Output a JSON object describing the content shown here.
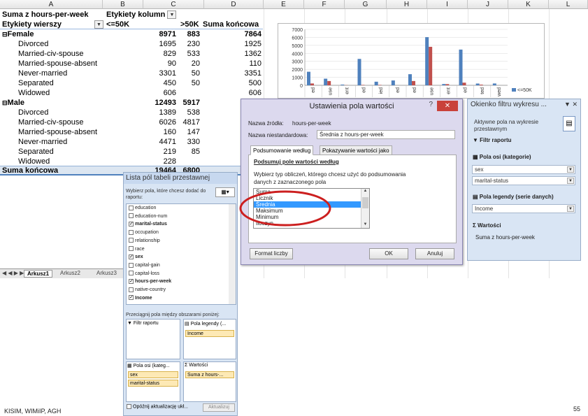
{
  "columns": [
    "A",
    "B",
    "C",
    "D",
    "E",
    "F",
    "G",
    "H",
    "I",
    "J",
    "K",
    "L"
  ],
  "pivot": {
    "title": "Suma z hours-per-week",
    "col_labels_header": "Etykiety kolumn",
    "row_labels_header": "Etykiety wierszy",
    "col1": "<=50K",
    "col2": ">50K",
    "col_total": "Suma końcowa",
    "rows": [
      {
        "label": "Female",
        "v1": "8971",
        "v2": "883",
        "t": "7864",
        "level": 0,
        "collapse": "⊟"
      },
      {
        "label": "Divorced",
        "v1": "1695",
        "v2": "230",
        "t": "1925",
        "level": 1
      },
      {
        "label": "Married-civ-spouse",
        "v1": "829",
        "v2": "533",
        "t": "1362",
        "level": 1
      },
      {
        "label": "Married-spouse-absent",
        "v1": "90",
        "v2": "20",
        "t": "110",
        "level": 1
      },
      {
        "label": "Never-married",
        "v1": "3301",
        "v2": "50",
        "t": "3351",
        "level": 1
      },
      {
        "label": "Separated",
        "v1": "450",
        "v2": "50",
        "t": "500",
        "level": 1
      },
      {
        "label": "Widowed",
        "v1": "606",
        "v2": "",
        "t": "606",
        "level": 1
      },
      {
        "label": "Male",
        "v1": "12493",
        "v2": "5917",
        "t": "",
        "level": 0,
        "collapse": "⊟"
      },
      {
        "label": "Divorced",
        "v1": "1389",
        "v2": "538",
        "t": "",
        "level": 1
      },
      {
        "label": "Married-civ-spouse",
        "v1": "6026",
        "v2": "4817",
        "t": "",
        "level": 1
      },
      {
        "label": "Married-spouse-absent",
        "v1": "160",
        "v2": "147",
        "t": "",
        "level": 1
      },
      {
        "label": "Never-married",
        "v1": "4471",
        "v2": "330",
        "t": "",
        "level": 1
      },
      {
        "label": "Separated",
        "v1": "219",
        "v2": "85",
        "t": "",
        "level": 1
      },
      {
        "label": "Widowed",
        "v1": "228",
        "v2": "",
        "t": "",
        "level": 1
      }
    ],
    "grand_label": "Suma końcowa",
    "grand_v1": "19464",
    "grand_v2": "6800"
  },
  "sheet_tabs": [
    "Arkusz1",
    "Arkusz2",
    "Arkusz3"
  ],
  "chart_data": {
    "type": "bar",
    "yticks": [
      "7000",
      "6000",
      "5000",
      "4000",
      "3000",
      "2000",
      "1000",
      "0"
    ],
    "ylim": [
      0,
      7000
    ],
    "categories": [
      "ed",
      "use",
      "ent",
      "ed",
      "ied",
      "ed",
      "ed",
      "use",
      "ent",
      "ed",
      "ted",
      "wed"
    ],
    "series": [
      {
        "name": "<=50K",
        "color": "#4f81bd",
        "values": [
          1695,
          829,
          90,
          3301,
          450,
          606,
          1389,
          6026,
          160,
          4471,
          219,
          228
        ]
      },
      {
        "name": "",
        "color": "#c0504d",
        "values": [
          230,
          533,
          20,
          50,
          50,
          0,
          538,
          4817,
          147,
          330,
          85,
          0
        ]
      }
    ],
    "legend": "right",
    "legend_label": "<=50K"
  },
  "dialog": {
    "title": "Ustawienia pola wartości",
    "min": "?",
    "close": "✕",
    "source_label": "Nazwa źródła:",
    "source_value": "hours-per-week",
    "custom_label": "Nazwa niestandardowa:",
    "custom_value": "Średnia z hours-per-week",
    "tab1": "Podsumowanie według",
    "tab2": "Pokazywanie wartości jako",
    "section": "Podsumuj pole wartości według",
    "hint1": "Wybierz typ obliczeń, którego chcesz użyć do podsumowania",
    "hint2": "danych z zaznaczonego pola",
    "options": [
      "Suma",
      "Licznik",
      "Średnia",
      "Maksimum",
      "Minimum",
      "Iloczyn"
    ],
    "selected_index": 2,
    "format_btn": "Format liczby",
    "ok_btn": "OK",
    "cancel_btn": "Anuluj"
  },
  "field_list": {
    "title": "Lista pól tabeli przestawnej",
    "hint": "Wybierz pola, które chcesz dodać do raportu:",
    "fields": [
      {
        "name": "education",
        "checked": false
      },
      {
        "name": "education-num",
        "checked": false
      },
      {
        "name": "marital-status",
        "checked": true,
        "bold": true
      },
      {
        "name": "occupation",
        "checked": false
      },
      {
        "name": "relationship",
        "checked": false
      },
      {
        "name": "race",
        "checked": false
      },
      {
        "name": "sex",
        "checked": true,
        "bold": true
      },
      {
        "name": "capital-gain",
        "checked": false
      },
      {
        "name": "capital-loss",
        "checked": false
      },
      {
        "name": "hours-per-week",
        "checked": true,
        "bold": true
      },
      {
        "name": "native-country",
        "checked": false
      },
      {
        "name": "Income",
        "checked": true,
        "bold": true
      }
    ],
    "drag_hint": "Przeciągnij pola między obszarami poniżej:",
    "area_filter": "Filtr raportu",
    "area_legend": "Pola legendy (...",
    "area_axis": "Pola osi (kateg...",
    "area_values": "Wartości",
    "legend_item": "Income",
    "axis_items": [
      "sex",
      "marital-status"
    ],
    "values_item": "Suma z hours-...",
    "defer": "Opóźnij aktualizację ukł...",
    "update": "Aktualizuj"
  },
  "filter_panel": {
    "title": "Okienko filtru wykresu ...",
    "active": "Aktywne pola na wykresie przestawnym",
    "report_filter": "Filtr raportu",
    "axis_fields": "Pola osi (kategorie)",
    "axis_items": [
      "sex",
      "marital-status"
    ],
    "legend_fields": "Pola legendy (serie danych)",
    "legend_item": "Income",
    "values": "Wartości",
    "values_item": "Suma z hours-per-week"
  },
  "footer": {
    "left": "KISIM, WIMiIP, AGH",
    "right": "55"
  }
}
